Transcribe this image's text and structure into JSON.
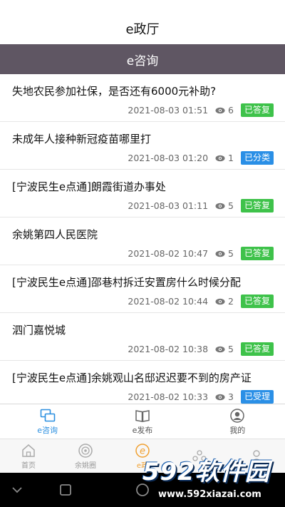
{
  "header": {
    "title": "e政厅"
  },
  "subheader": {
    "title": "e咨询"
  },
  "items": [
    {
      "question": "失地农民参加社保，是否还有6000元补助?",
      "time": "2021-08-03 01:51",
      "views": "6",
      "status": "已答复",
      "status_color": "#3ec24a"
    },
    {
      "question": "未成年人接种新冠疫苗哪里打",
      "time": "2021-08-03 01:20",
      "views": "1",
      "status": "已分类",
      "status_color": "#2a8fe6"
    },
    {
      "question": "[宁波民生e点通]朗霞街道办事处",
      "time": "2021-08-03 01:11",
      "views": "5",
      "status": "已答复",
      "status_color": "#3ec24a"
    },
    {
      "question": "余姚第四人民医院",
      "time": "2021-08-02 10:47",
      "views": "5",
      "status": "已答复",
      "status_color": "#3ec24a"
    },
    {
      "question": "[宁波民生e点通]邵巷村拆迁安置房什么时候分配",
      "time": "2021-08-02 10:44",
      "views": "2",
      "status": "已答复",
      "status_color": "#3ec24a"
    },
    {
      "question": "泗门嘉悦城",
      "time": "2021-08-02 10:38",
      "views": "5",
      "status": "已答复",
      "status_color": "#3ec24a"
    },
    {
      "question": "[宁波民生e点通]余姚观山名邸迟迟要不到的房产证",
      "time": "2021-08-02 10:33",
      "views": "3",
      "status": "已受理",
      "status_color": "#2a8fe6"
    }
  ],
  "subtabs": [
    {
      "label": "e咨询",
      "icon": "chat-icon",
      "active": true
    },
    {
      "label": "e发布",
      "icon": "book-icon",
      "active": false
    },
    {
      "label": "我的",
      "icon": "user-icon",
      "active": false
    }
  ],
  "maintabs": [
    {
      "label": "首页",
      "icon": "home-icon"
    },
    {
      "label": "余姚圈",
      "icon": "circle-icon"
    },
    {
      "label": "e政",
      "icon": "e-icon"
    },
    {
      "label": "",
      "icon": "people-icon"
    },
    {
      "label": "",
      "icon": "profile-icon"
    }
  ],
  "watermark": {
    "logo": "592软件园",
    "url": "www.592xiazai.com"
  },
  "accent": "#2b8fe0"
}
